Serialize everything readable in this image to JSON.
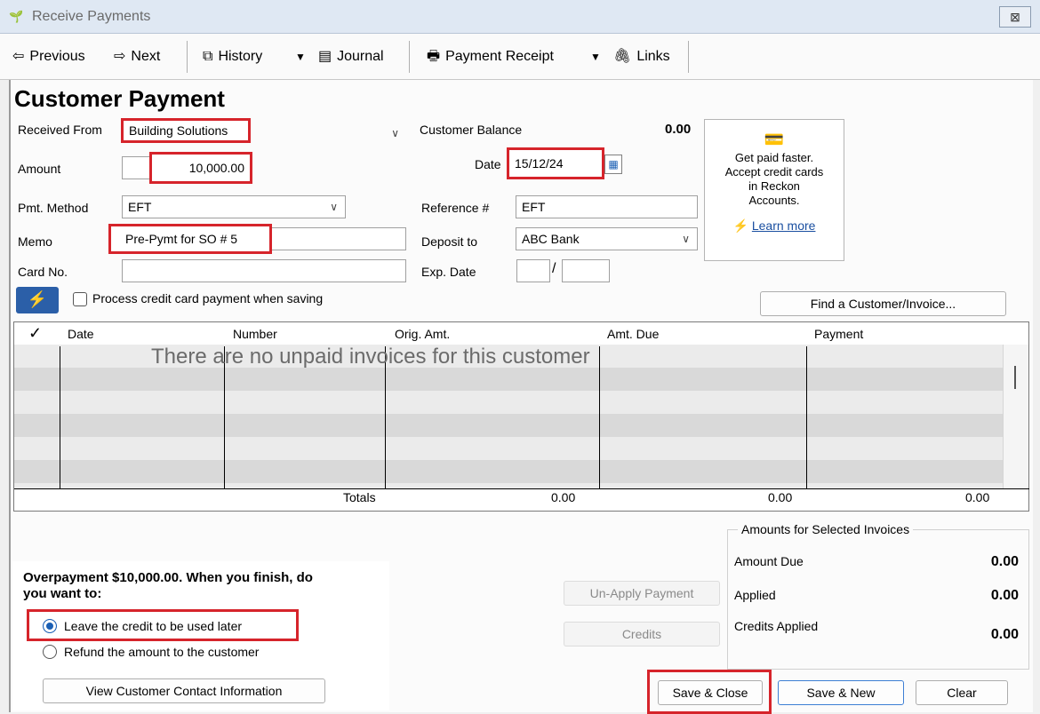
{
  "window": {
    "title": "Receive Payments",
    "close_glyph": "⊠"
  },
  "toolbar": {
    "previous": "Previous",
    "next": "Next",
    "history": "History",
    "journal": "Journal",
    "payment_receipt": "Payment Receipt",
    "links": "Links"
  },
  "form": {
    "title": "Customer Payment",
    "received_from_label": "Received From",
    "received_from_value": "Building Solutions",
    "customer_balance_label": "Customer Balance",
    "customer_balance_value": "0.00",
    "amount_label": "Amount",
    "amount_value": "10,000.00",
    "date_label": "Date",
    "date_value": "15/12/24",
    "pmt_method_label": "Pmt. Method",
    "pmt_method_value": "EFT",
    "reference_label": "Reference #",
    "reference_value": "EFT",
    "memo_label": "Memo",
    "memo_value": "Pre-Pymt for SO # 5",
    "deposit_label": "Deposit to",
    "deposit_value": "ABC Bank",
    "card_label": "Card No.",
    "card_value": "",
    "exp_label": "Exp. Date",
    "exp_sep": "/",
    "process_cc_label": "Process credit card payment when saving",
    "find_button": "Find a Customer/Invoice..."
  },
  "ad": {
    "line1": "Get paid faster.",
    "line2": "Accept credit cards",
    "line3": "in Reckon",
    "line4": "Accounts.",
    "learn_more": "Learn more"
  },
  "grid": {
    "check_header": "✓",
    "columns": [
      "Date",
      "Number",
      "Orig. Amt.",
      "Amt. Due",
      "Payment"
    ],
    "empty_message": "There are no unpaid invoices for this customer",
    "totals_label": "Totals",
    "totals": {
      "orig": "0.00",
      "due": "0.00",
      "payment": "0.00"
    }
  },
  "overpayment": {
    "message_line1": "Overpayment $10,000.00. When you finish, do",
    "message_line2": "you want to:",
    "option_leave": "Leave the credit to be used later",
    "option_refund": "Refund the amount to the customer",
    "contact_button": "View Customer Contact Information"
  },
  "actions": {
    "unapply": "Un-Apply Payment",
    "credits": "Credits",
    "save_close": "Save & Close",
    "save_new": "Save & New",
    "clear": "Clear"
  },
  "amounts": {
    "legend": "Amounts for Selected Invoices",
    "amount_due_label": "Amount Due",
    "amount_due_value": "0.00",
    "applied_label": "Applied",
    "applied_value": "0.00",
    "credits_applied_label": "Credits Applied",
    "credits_applied_value": "0.00"
  }
}
